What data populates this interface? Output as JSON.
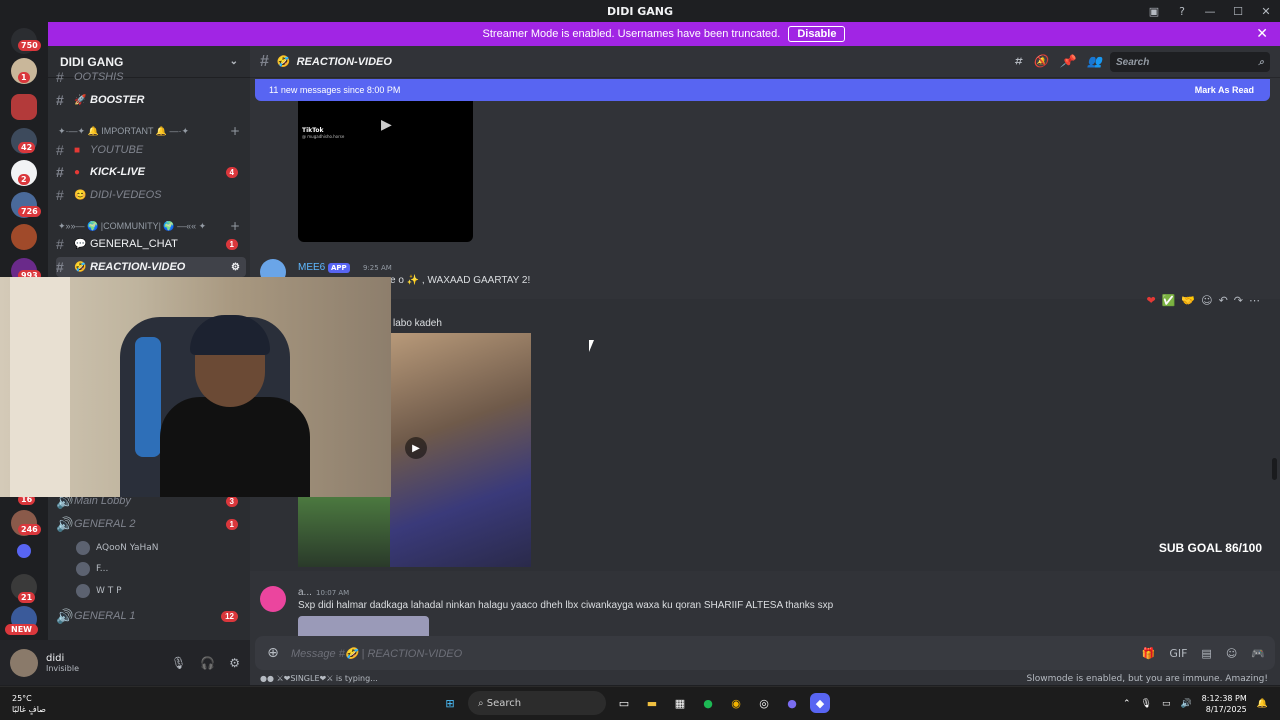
{
  "window": {
    "title": "DIDI GANG"
  },
  "banner": {
    "text": "Streamer Mode is enabled. Usernames have been truncated.",
    "disable_label": "Disable"
  },
  "servers": {
    "badges": [
      "750",
      "1",
      "42",
      "2",
      "726",
      "993",
      "16",
      "246",
      "21"
    ],
    "new_label": "NEW"
  },
  "guild": {
    "name": "DIDI GANG"
  },
  "channels": {
    "top_partial": "OOTSHIS",
    "booster": "BOOSTER",
    "cat_important": "✦·—✦ 🔔 IMPORTANT 🔔 —·✦",
    "youtube": "YOUTUBE",
    "kick_live": "KICK-LIVE",
    "kick_badge": "4",
    "didi_videos": "DIDI-VEDEOS",
    "cat_community": "✦»»— 🌍 |COMMUNITY| 🌍 —«« ✦",
    "general_chat": "GENERAL_CHAT",
    "general_chat_badge": "1",
    "reaction_video": "REACTION-VIDEO",
    "main_lobby": "Main Lobby",
    "main_lobby_badge": "3",
    "general2": "GENERAL 2",
    "general2_badge": "1",
    "vc_users": [
      "AQooN YaHaN",
      "F...",
      "W T P"
    ],
    "general1": "GENERAL 1",
    "general1_badge": "12"
  },
  "user": {
    "name": "didi",
    "status": "Invisible"
  },
  "channel_header": {
    "name": "REACTION-VIDEO",
    "search_placeholder": "Search"
  },
  "new_messages": {
    "text": "11 new messages since 8:00 PM",
    "mark_read": "Mark As Read"
  },
  "tiktok": {
    "brand": "TikTok",
    "handle": "@ mugadhisho.horse"
  },
  "messages": [
    {
      "author": "MEE6",
      "badge": "APP",
      "time": "9:25 AM",
      "text": "e o ✨ , WAXAAD GAARTAY  2!"
    },
    {
      "author": "",
      "text": "labo kadeh"
    },
    {
      "author": "a...",
      "time": "10:07 AM",
      "text": "Sxp didi halmar dadkaga lahadal ninkan halagu yaaco dheh lbx ciwankayga waxa ku qoran SHARIIF ALTESA thanks sxp"
    }
  ],
  "overlay": {
    "sub_goal": "SUB GOAL 86/100"
  },
  "composer": {
    "placeholder": "Message #🤣 | REACTION-VIDEO"
  },
  "footer": {
    "typing": "●● ⚔❤SINGLE❤⚔ is typing...",
    "slowmode": "Slowmode is enabled, but you are immune. Amazing!"
  },
  "taskbar": {
    "temp": "25°C",
    "weather_desc": "صافٍ غالبًا",
    "search": "Search",
    "time": "8:12:38 PM",
    "date": "8/17/2025"
  },
  "colors": {
    "accent": "#5865f2",
    "banner": "#a125e4",
    "badge": "#da373c"
  }
}
